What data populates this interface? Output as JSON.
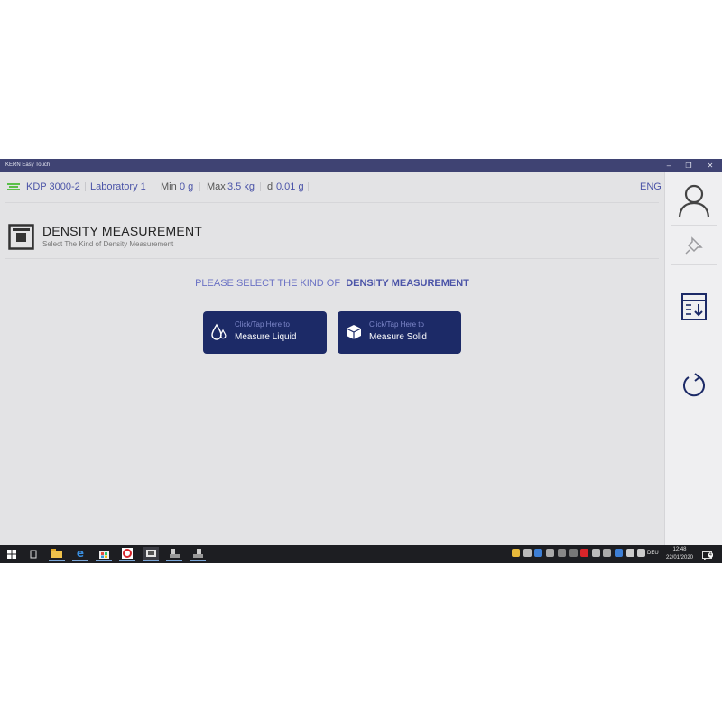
{
  "window": {
    "title": "KERN Easy Touch",
    "controls": [
      "–",
      "❐",
      "✕"
    ]
  },
  "statusbar": {
    "model": "KDP 3000-2",
    "location": "Laboratory 1",
    "min_label": "Min",
    "min_value": "0 g",
    "max_label": "Max",
    "max_value": "3.5 kg",
    "d_label": "d",
    "d_value": "0.01 g",
    "language": "ENG"
  },
  "page": {
    "title": "DENSITY MEASUREMENT",
    "subtitle": "Select The Kind of Density Measurement",
    "prompt_prefix": "PLEASE SELECT THE KIND OF",
    "prompt_emphasis": "DENSITY MEASUREMENT"
  },
  "buttons": [
    {
      "hint": "Click/Tap Here to",
      "label": "Measure Liquid",
      "icon": "drops-icon"
    },
    {
      "hint": "Click/Tap Here to",
      "label": "Measure Solid",
      "icon": "cube-icon"
    }
  ],
  "sidebar": {
    "items": [
      {
        "icon": "user-icon"
      },
      {
        "icon": "pin-icon"
      },
      {
        "icon": "export-icon"
      },
      {
        "icon": "refresh-icon"
      }
    ]
  },
  "taskbar": {
    "apps": [
      "windows-start-icon",
      "task-view-icon",
      "file-explorer-icon",
      "edge-icon",
      "store-icon",
      "app-icon",
      "kern-app-icon",
      "scale-app-icon",
      "scale-app-icon-2"
    ],
    "language": "DEU",
    "time": "12:48",
    "date": "22/01/2020",
    "notifications": "4"
  },
  "colors": {
    "titlebar": "#3f4373",
    "button": "#1c2a67",
    "accent": "#4b54a8",
    "scale_status": "#5bbf4a"
  }
}
